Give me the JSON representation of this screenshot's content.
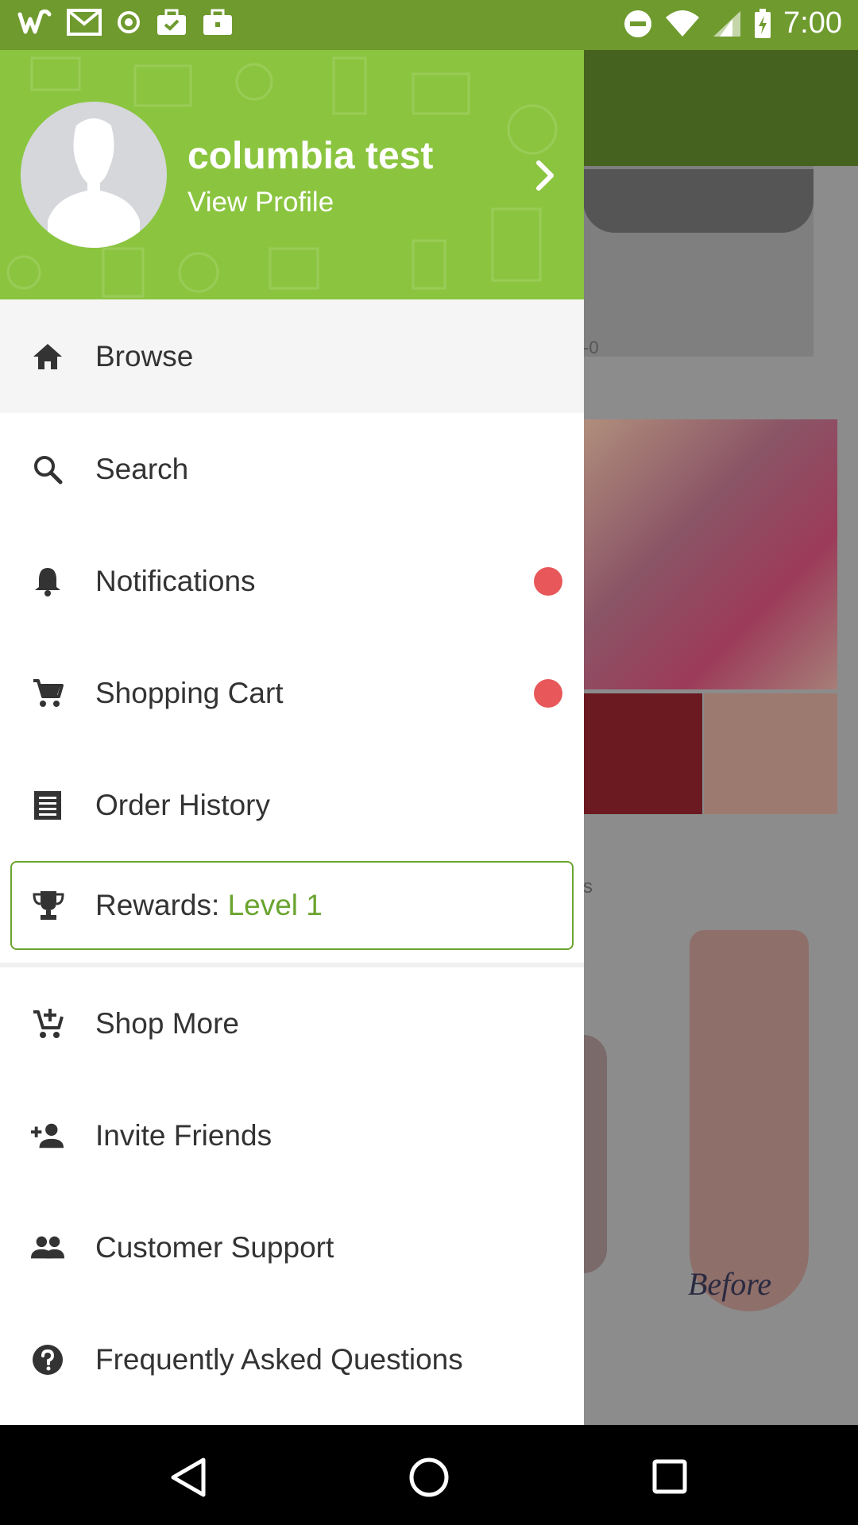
{
  "status_bar": {
    "time": "7:00",
    "left_icons": [
      "wish-icon",
      "gmail-icon",
      "record-icon",
      "briefcase-check-icon",
      "briefcase-icon"
    ],
    "right_icons": [
      "dnd-icon",
      "wifi-icon",
      "signal-icon",
      "battery-charging-icon"
    ]
  },
  "profile": {
    "name": "columbia test",
    "link": "View Profile"
  },
  "menu": {
    "browse": "Browse",
    "search": "Search",
    "notifications": "Notifications",
    "cart": "Shopping Cart",
    "orders": "Order History",
    "rewards_label": "Rewards: ",
    "rewards_level": "Level 1",
    "shop_more": "Shop More",
    "invite": "Invite Friends",
    "support": "Customer Support",
    "faq": "Frequently Asked Questions"
  },
  "background": {
    "partial_price": "-0",
    "partial_text": "s",
    "before_label": "Before"
  },
  "colors": {
    "accent": "#8bc540",
    "status_bar": "#6f9a2e",
    "badge": "#e8585a",
    "rewards": "#6aa42f"
  }
}
